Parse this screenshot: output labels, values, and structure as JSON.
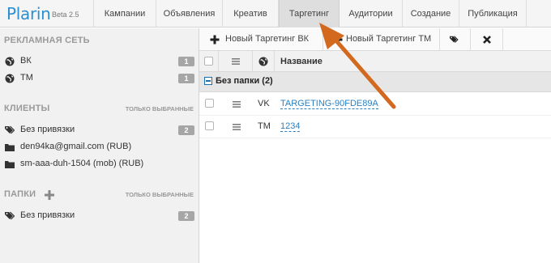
{
  "app": {
    "name": "Plarin",
    "version": "Beta 2.5"
  },
  "nav": {
    "tabs": [
      {
        "label": "Кампании"
      },
      {
        "label": "Объявления"
      },
      {
        "label": "Креатив"
      },
      {
        "label": "Таргетинг",
        "active": true
      },
      {
        "label": "Аудитории"
      },
      {
        "label": "Создание"
      },
      {
        "label": "Публикация"
      }
    ]
  },
  "sidebar": {
    "networks": {
      "title": "Рекламная сеть",
      "items": [
        {
          "label": "ВК",
          "count": "1",
          "icon": "globe-icon"
        },
        {
          "label": "ТМ",
          "count": "1",
          "icon": "globe-icon"
        }
      ]
    },
    "clients": {
      "title": "Клиенты",
      "note": "только выбранные",
      "items": [
        {
          "label": "Без привязки",
          "count": "2",
          "icon": "tags-icon"
        },
        {
          "label": "den94ka@gmail.com (RUB)",
          "icon": "folder-icon"
        },
        {
          "label": "sm-aaa-duh-1504 (mob) (RUB)",
          "icon": "folder-icon"
        }
      ]
    },
    "folders": {
      "title": "Папки",
      "note": "только выбранные",
      "items": [
        {
          "label": "Без привязки",
          "count": "2",
          "icon": "tags-icon"
        }
      ]
    }
  },
  "toolbar": {
    "new_vk": "Новый Таргетинг ВК",
    "new_tm": "Новый Таргетинг ТМ"
  },
  "table": {
    "header": {
      "name": "Название"
    },
    "group": {
      "label": "Без папки (2)"
    },
    "rows": [
      {
        "network": "VK",
        "name": "TARGETING-90FDE89A"
      },
      {
        "network": "TM",
        "name": "1234"
      }
    ]
  },
  "colors": {
    "brand": "#2b8fd0",
    "link": "#2a7fc0",
    "annotation_arrow": "#d2691e"
  }
}
